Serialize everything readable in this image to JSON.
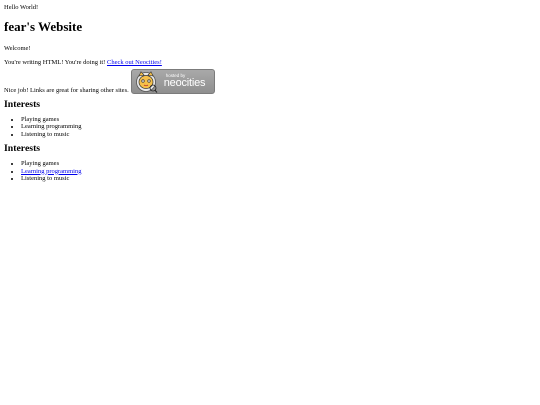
{
  "page": {
    "hello": "Hello World!",
    "title": "fear's Website",
    "welcome": "Welcome!",
    "writing_text": "You're writing HTML! You're doing it!",
    "neocities_link": "Check out Neocities!",
    "nice_job": "Nice job! Links are great for sharing other sites.",
    "badge": {
      "small": "hosted by",
      "big": "neocities"
    },
    "sections": [
      {
        "heading": "Interests",
        "items": [
          "Playing games",
          "Learning programming",
          "Listening to music"
        ]
      },
      {
        "heading": "Interests",
        "items": [
          "Playing games",
          "Learning programming",
          "Listening to music"
        ]
      }
    ]
  },
  "colors": {
    "link": "#0000ee",
    "badge_bg": "#9c9c9c",
    "text": "#000000"
  }
}
